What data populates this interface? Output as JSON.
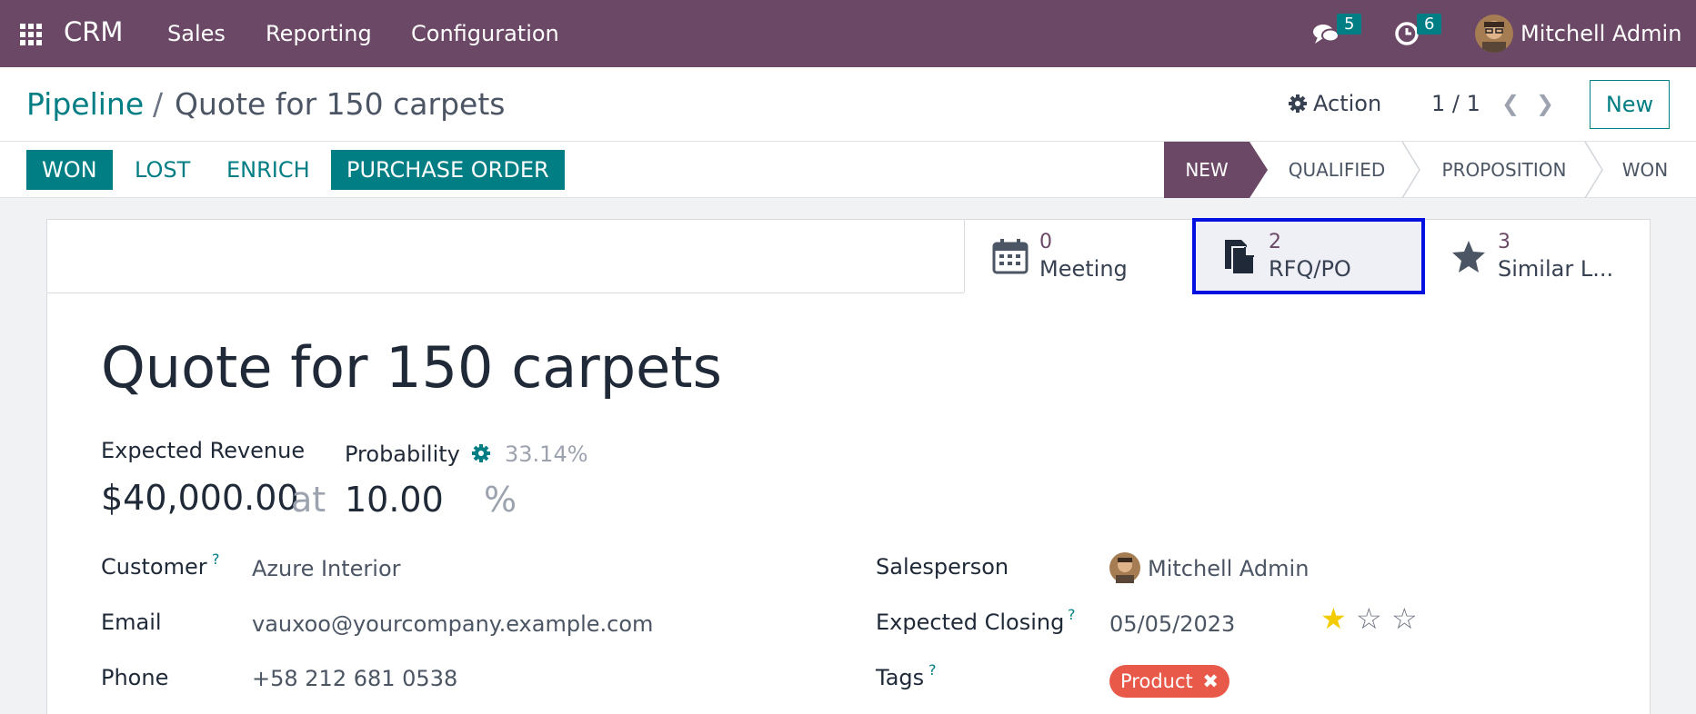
{
  "navbar": {
    "brand": "CRM",
    "menu": [
      "Sales",
      "Reporting",
      "Configuration"
    ],
    "messages_count": "5",
    "activities_count": "6",
    "user_name": "Mitchell Admin"
  },
  "breadcrumb": {
    "parent": "Pipeline",
    "separator": "/",
    "current": "Quote for 150 carpets"
  },
  "control": {
    "action_label": "Action",
    "pager": "1 / 1",
    "new_label": "New"
  },
  "statusbar": {
    "buttons": [
      "WON",
      "LOST",
      "ENRICH",
      "PURCHASE ORDER"
    ],
    "stages": [
      "NEW",
      "QUALIFIED",
      "PROPOSITION",
      "WON"
    ],
    "active_stage": "NEW"
  },
  "smart_buttons": [
    {
      "count": "0",
      "label": "Meeting",
      "icon": "calendar-icon"
    },
    {
      "count": "2",
      "label": "RFQ/PO",
      "icon": "document-icon"
    },
    {
      "count": "3",
      "label": "Similar L...",
      "icon": "star-icon"
    }
  ],
  "form": {
    "title": "Quote for 150 carpets",
    "expected_revenue_label": "Expected Revenue",
    "expected_revenue": "$40,000.00",
    "at": "at",
    "probability_label": "Probability",
    "probability_auto": "33.14%",
    "probability": "10.00",
    "percent": "%",
    "customer_label": "Customer",
    "customer": "Azure Interior",
    "email_label": "Email",
    "email": "vauxoo@yourcompany.example.com",
    "phone_label": "Phone",
    "phone": "+58 212 681 0538",
    "salesperson_label": "Salesperson",
    "salesperson": "Mitchell Admin",
    "closing_label": "Expected Closing",
    "closing": "05/05/2023",
    "priority_stars": 1,
    "tags_label": "Tags",
    "tag": "Product",
    "help_mark": "?"
  },
  "colors": {
    "brand": "#6b4866",
    "accent": "#017e84",
    "tag": "#e9594a",
    "highlight": "#0010e0"
  }
}
